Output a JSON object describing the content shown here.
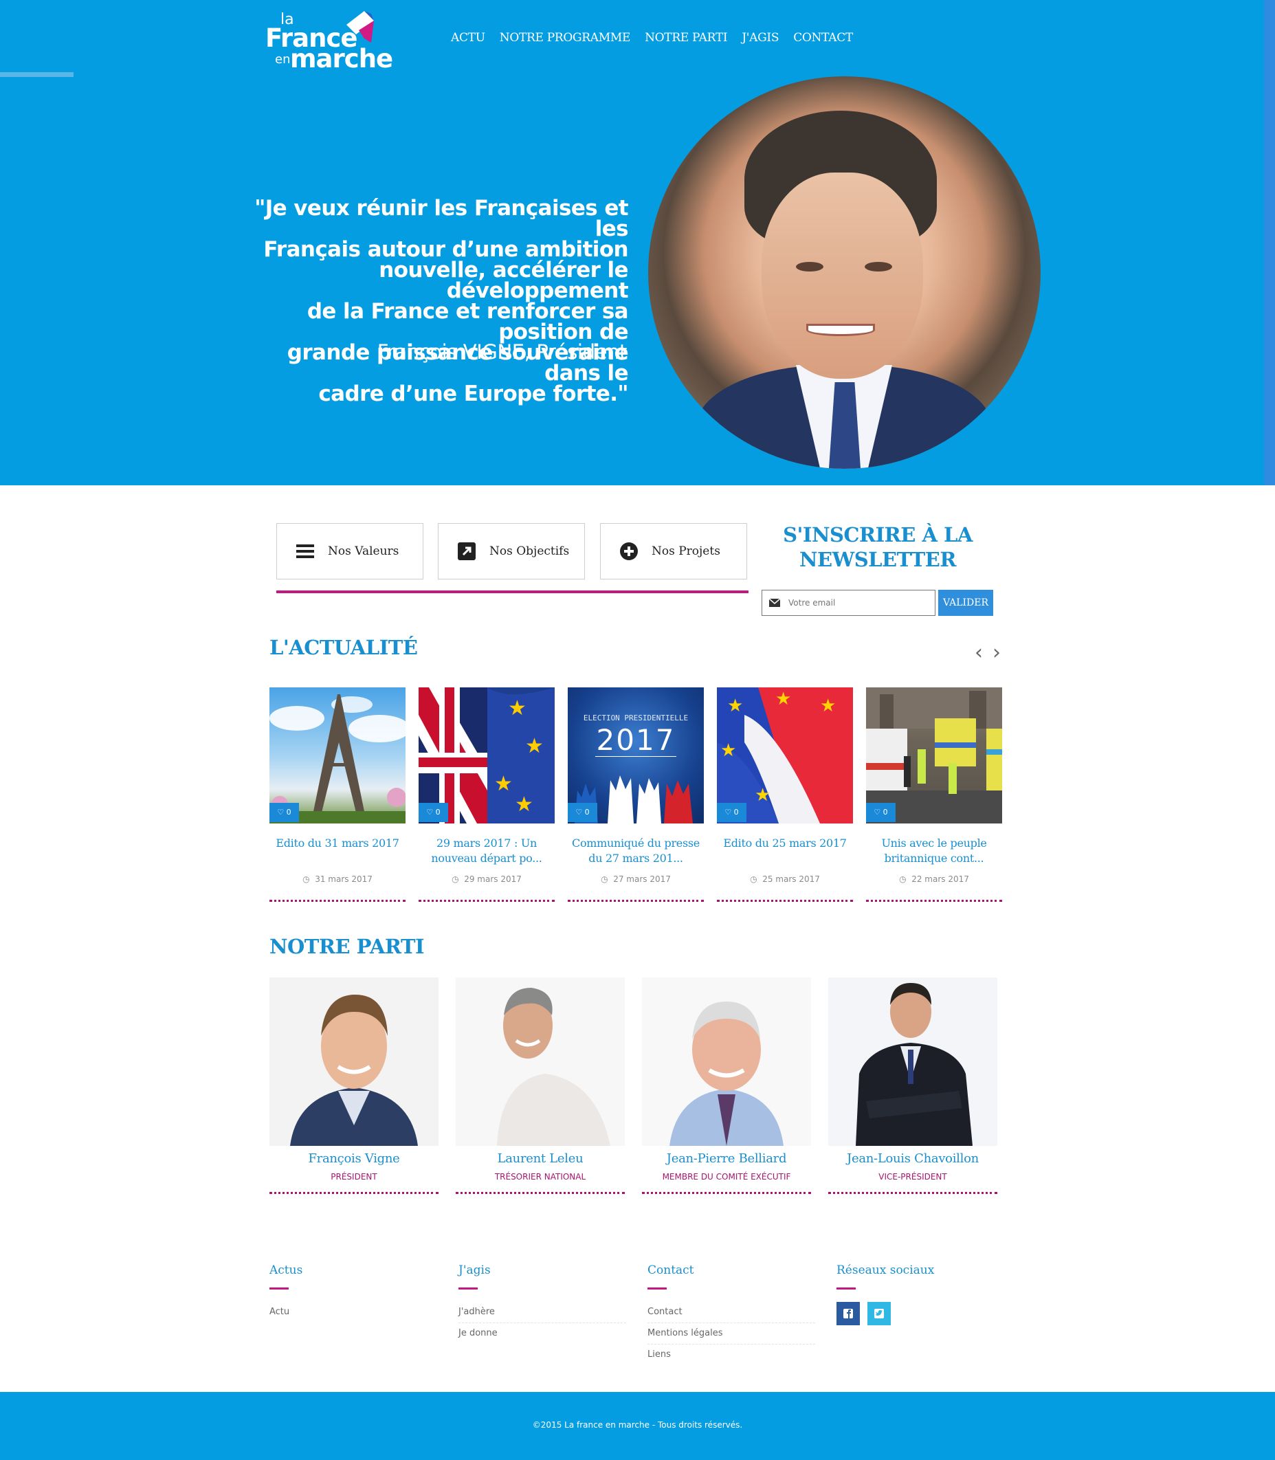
{
  "header": {
    "logo": {
      "la": "la",
      "france": "France",
      "en": "en",
      "marche": "marche"
    },
    "nav": [
      "ACTU",
      "NOTRE PROGRAMME",
      "NOTRE PARTI",
      "J'AGIS",
      "CONTACT"
    ]
  },
  "hero": {
    "quote_lines": [
      "\"Je veux réunir les Françaises et les",
      "Français autour d’une ambition",
      "nouvelle, accélérer le développement",
      "de la France et renforcer sa position de",
      "grande puissance souveraine dans le",
      "cadre d’une Europe forte.\""
    ],
    "author": "François VIGNE, Président"
  },
  "values": [
    {
      "label": "Nos Valeurs",
      "icon": "bars-icon"
    },
    {
      "label": "Nos Objectifs",
      "icon": "external-link-icon"
    },
    {
      "label": "Nos Projets",
      "icon": "plus-circle-icon"
    }
  ],
  "newsletter": {
    "title_line1": "S'INSCRIRE À LA",
    "title_line2": "NEWSLETTER",
    "placeholder": "Votre email",
    "button": "VALIDER"
  },
  "news": {
    "title": "L'ACTUALITÉ",
    "items": [
      {
        "title_lines": [
          "Edito du 31 mars 2017",
          ""
        ],
        "date": "31 mars 2017",
        "likes": "0",
        "image": "eiffel-tower"
      },
      {
        "title_lines": [
          "29 mars 2017 : Un",
          "nouveau départ po..."
        ],
        "date": "29 mars 2017",
        "likes": "0",
        "image": "uk-eu-flags"
      },
      {
        "title_lines": [
          "Communiqué du presse",
          "du 27 mars 201..."
        ],
        "date": "27 mars 2017",
        "likes": "0",
        "image": "election-2017",
        "image_text_1": "ELECTION PRESIDENTIELLE",
        "image_text_2": "2017"
      },
      {
        "title_lines": [
          "Edito du 25 mars 2017",
          ""
        ],
        "date": "25 mars 2017",
        "likes": "0",
        "image": "fr-eu-flags"
      },
      {
        "title_lines": [
          "Unis avec le peuple",
          "britannique cont..."
        ],
        "date": "22 mars 2017",
        "likes": "0",
        "image": "london-street"
      }
    ]
  },
  "party": {
    "title": "NOTRE PARTI",
    "members": [
      {
        "name": "François Vigne",
        "role": "PRÉSIDENT"
      },
      {
        "name": "Laurent Leleu",
        "role": "TRÉSORIER NATIONAL"
      },
      {
        "name": "Jean-Pierre Belliard",
        "role": "MEMBRE DU COMITÉ EXÉCUTIF"
      },
      {
        "name": "Jean-Louis Chavoillon",
        "role": "VICE-PRÉSIDENT"
      }
    ]
  },
  "footer": {
    "columns": [
      {
        "title": "Actus",
        "links": [
          "Actu"
        ]
      },
      {
        "title": "J'agis",
        "links": [
          "J'adhère",
          "Je donne"
        ]
      },
      {
        "title": "Contact",
        "links": [
          "Contact",
          "Mentions légales",
          "Liens"
        ]
      },
      {
        "title": "Réseaux sociaux",
        "social": [
          "facebook-icon",
          "twitter-icon"
        ]
      }
    ],
    "copyright": "©2015 La france en marche - Tous droits réservés."
  },
  "colors": {
    "brand_blue": "#059de1",
    "title_blue": "#1a8fcf",
    "accent_pink": "#c3187f",
    "button_blue": "#2f8fdc"
  }
}
